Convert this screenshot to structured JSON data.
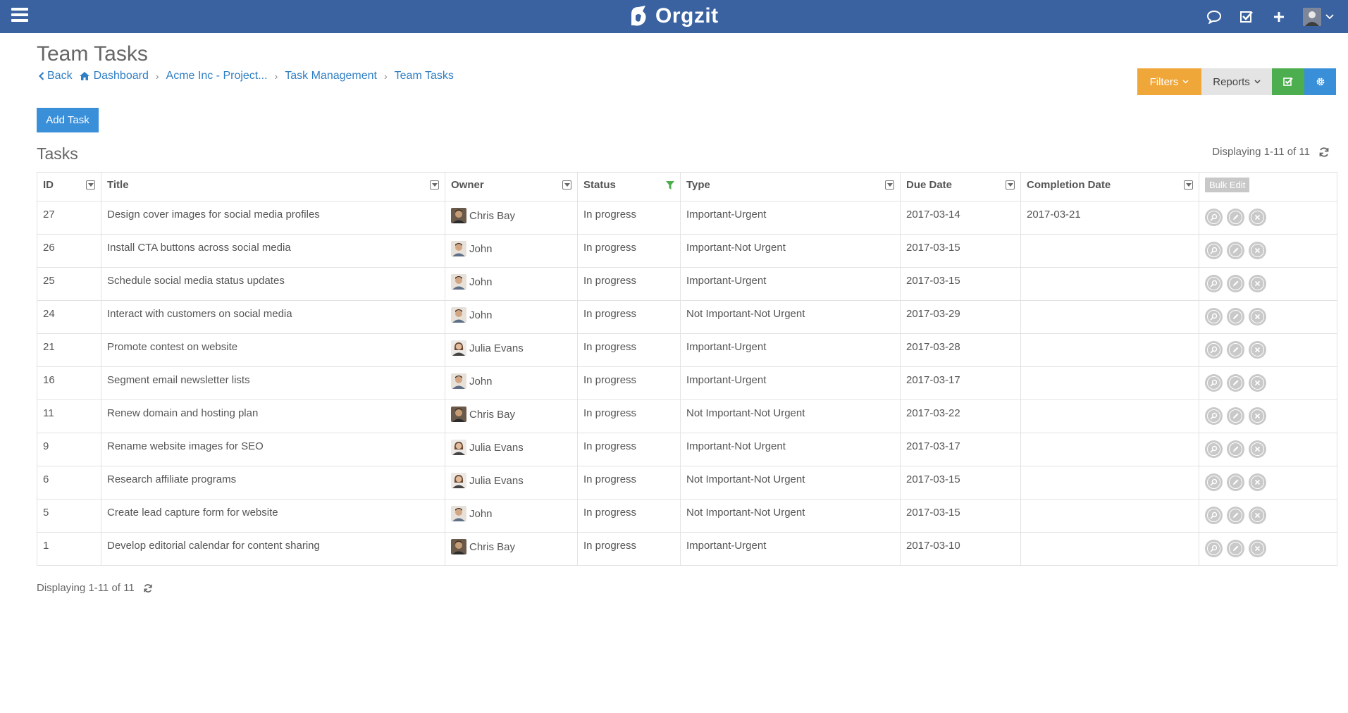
{
  "navbar": {
    "brand": "Orgzit",
    "icons": [
      "menu-icon",
      "chat-icon",
      "task-check-icon",
      "plus-icon",
      "user-avatar"
    ]
  },
  "page": {
    "title": "Team Tasks",
    "breadcrumb": {
      "back": "Back",
      "items": [
        "Dashboard",
        "Acme Inc - Project...",
        "Task Management",
        "Team Tasks"
      ]
    }
  },
  "toolbar": {
    "filters_label": "Filters",
    "reports_label": "Reports"
  },
  "add_task_label": "Add Task",
  "section_title": "Tasks",
  "display_text": "Displaying 1-11 of 11",
  "table": {
    "columns": [
      "ID",
      "Title",
      "Owner",
      "Status",
      "Type",
      "Due Date",
      "Completion Date"
    ],
    "bulk_edit_label": "Bulk Edit",
    "rows": [
      {
        "id": "27",
        "title": "Design cover images for social media profiles",
        "owner": "Chris Bay",
        "status": "In progress",
        "type": "Important-Urgent",
        "due": "2017-03-14",
        "completed": "2017-03-21"
      },
      {
        "id": "26",
        "title": "Install CTA buttons across social media",
        "owner": "John",
        "status": "In progress",
        "type": "Important-Not Urgent",
        "due": "2017-03-15",
        "completed": ""
      },
      {
        "id": "25",
        "title": "Schedule social media status updates",
        "owner": "John",
        "status": "In progress",
        "type": "Important-Urgent",
        "due": "2017-03-15",
        "completed": ""
      },
      {
        "id": "24",
        "title": "Interact with customers on social media",
        "owner": "John",
        "status": "In progress",
        "type": "Not Important-Not Urgent",
        "due": "2017-03-29",
        "completed": ""
      },
      {
        "id": "21",
        "title": "Promote contest on website",
        "owner": "Julia Evans",
        "status": "In progress",
        "type": "Important-Urgent",
        "due": "2017-03-28",
        "completed": ""
      },
      {
        "id": "16",
        "title": "Segment email newsletter lists",
        "owner": "John",
        "status": "In progress",
        "type": "Important-Urgent",
        "due": "2017-03-17",
        "completed": ""
      },
      {
        "id": "11",
        "title": "Renew domain and hosting plan",
        "owner": "Chris Bay",
        "status": "In progress",
        "type": "Not Important-Not Urgent",
        "due": "2017-03-22",
        "completed": ""
      },
      {
        "id": "9",
        "title": "Rename website images for SEO",
        "owner": "Julia Evans",
        "status": "In progress",
        "type": "Important-Not Urgent",
        "due": "2017-03-17",
        "completed": ""
      },
      {
        "id": "6",
        "title": "Research affiliate programs",
        "owner": "Julia Evans",
        "status": "In progress",
        "type": "Not Important-Not Urgent",
        "due": "2017-03-15",
        "completed": ""
      },
      {
        "id": "5",
        "title": "Create lead capture form for website",
        "owner": "John",
        "status": "In progress",
        "type": "Not Important-Not Urgent",
        "due": "2017-03-15",
        "completed": ""
      },
      {
        "id": "1",
        "title": "Develop editorial calendar for content sharing",
        "owner": "Chris Bay",
        "status": "In progress",
        "type": "Important-Urgent",
        "due": "2017-03-10",
        "completed": ""
      }
    ]
  },
  "colors": {
    "navbar": "#3a62a0",
    "link": "#2f7fc4",
    "filters": "#f0a73a",
    "check": "#4dae4f",
    "primary": "#3a8fd9"
  }
}
